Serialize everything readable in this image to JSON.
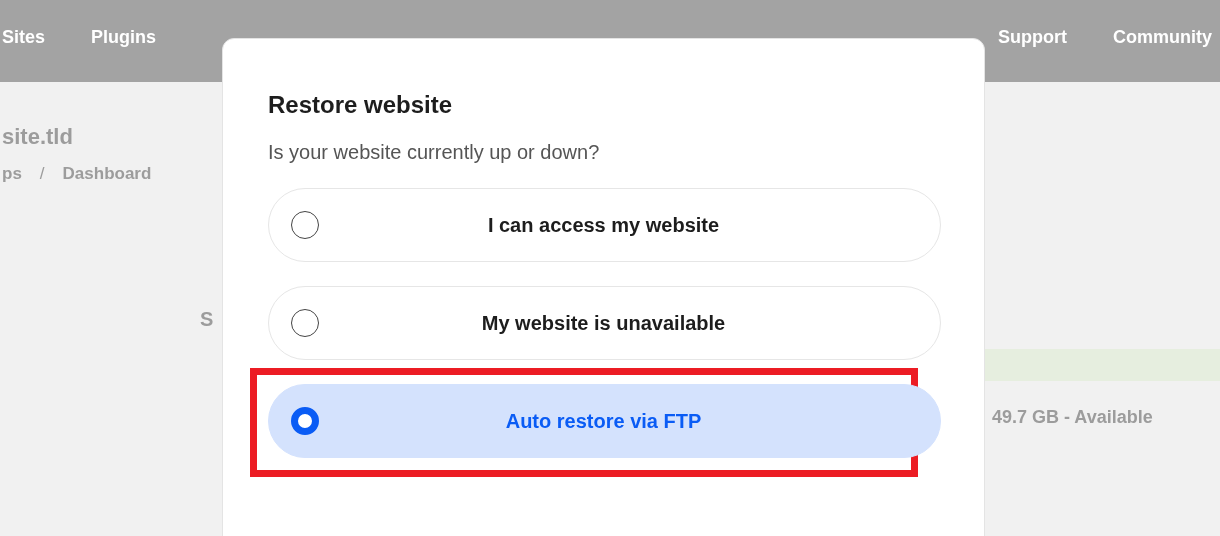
{
  "nav": {
    "items": [
      {
        "label": "Sites"
      },
      {
        "label": "Plugins"
      },
      {
        "label": "Support"
      },
      {
        "label": "Community"
      }
    ]
  },
  "page": {
    "title": "site.tld",
    "breadcrumbs": [
      {
        "label": "ps"
      },
      {
        "label": "/",
        "kind": "separator"
      },
      {
        "label": "Dashboard"
      }
    ],
    "section_label": "S",
    "storage_text": "49.7 GB - Available"
  },
  "modal": {
    "title": "Restore website",
    "question": "Is your website currently up or down?",
    "options": [
      {
        "label": "I can access my website",
        "selected": false,
        "highlighted": false
      },
      {
        "label": "My website is unavailable",
        "selected": false,
        "highlighted": false
      },
      {
        "label": "Auto restore via FTP",
        "selected": true,
        "highlighted": true
      }
    ]
  }
}
